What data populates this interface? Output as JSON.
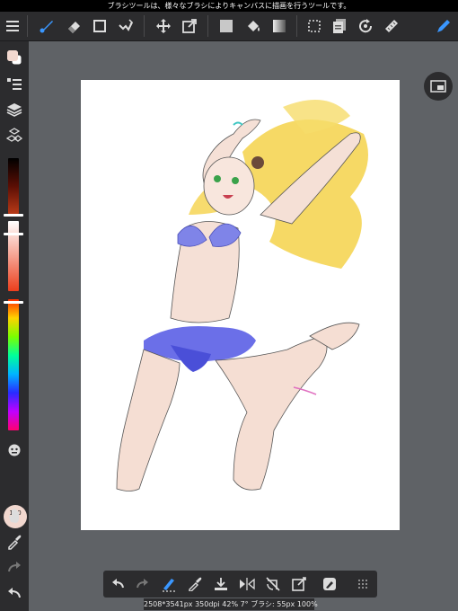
{
  "status_bar": {
    "message": "ブラシツールは、様々なブラシによりキャンバスに描画を行うツールです。"
  },
  "top_toolbar": {
    "tools": [
      {
        "icon": "menu-icon"
      },
      {
        "icon": "brush-icon",
        "active": true
      },
      {
        "icon": "eraser-icon"
      },
      {
        "icon": "select-rect-icon"
      },
      {
        "icon": "lasso-icon"
      },
      {
        "icon": "move-icon"
      },
      {
        "icon": "transform-icon"
      },
      {
        "icon": "fill-rect-icon"
      },
      {
        "icon": "bucket-icon"
      },
      {
        "icon": "gradient-icon"
      },
      {
        "icon": "select-dotted-icon"
      },
      {
        "icon": "layers-copy-icon"
      },
      {
        "icon": "rotate-icon"
      },
      {
        "icon": "ruler-icon"
      },
      {
        "icon": "pen-active-icon"
      }
    ]
  },
  "left_toolbar": {
    "opacity_percent": "100",
    "opacity_unit": "%",
    "tools": [
      "color-swatch-icon",
      "layer-list-icon",
      "layers-icon",
      "materials-icon",
      "hand-icon",
      "eyedropper-icon",
      "redo-icon",
      "undo-icon"
    ]
  },
  "colors": {
    "foreground": "#f2d8cf",
    "accent": "#2f8cff"
  },
  "bottom_toolbar": {
    "tools": [
      "undo-icon",
      "redo-icon",
      "brush-stroke-icon",
      "eyedropper-icon",
      "save-icon",
      "flip-icon",
      "no-rotate-icon",
      "snap-icon",
      "edit-icon",
      "grid-menu-icon"
    ]
  },
  "info_bar": {
    "text": "2508*3541px 350dpi 42% 7° ブラシ: 55px 100%"
  }
}
